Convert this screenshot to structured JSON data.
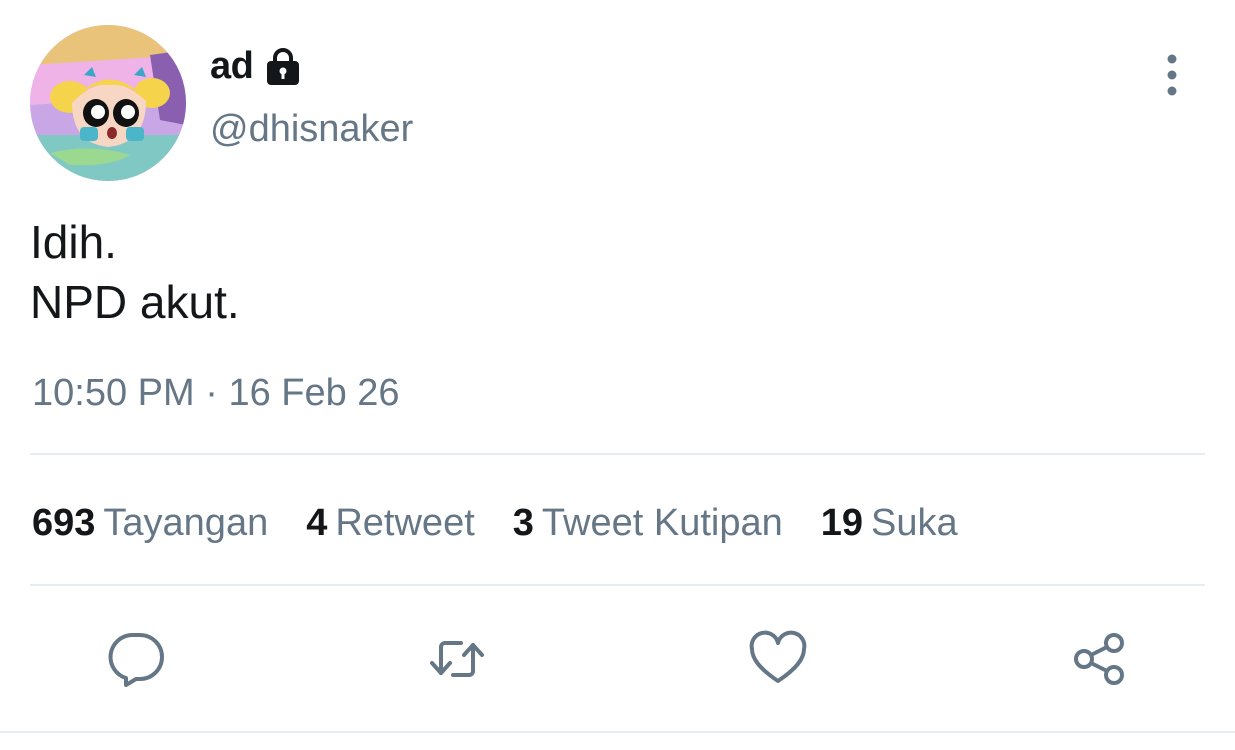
{
  "author": {
    "display_name": "ad",
    "handle": "@dhisnaker",
    "avatar_icon": "avatar-cartoon-girl",
    "protected_icon": "lock-icon"
  },
  "tweet": {
    "lines": [
      "Idih.",
      "NPD akut."
    ],
    "time": "10:50 PM",
    "separator": "·",
    "date": "16 Feb 26"
  },
  "stats": [
    {
      "count": "693",
      "label": "Tayangan"
    },
    {
      "count": "4",
      "label": "Retweet"
    },
    {
      "count": "3",
      "label": "Tweet Kutipan"
    },
    {
      "count": "19",
      "label": "Suka"
    }
  ],
  "actions": {
    "reply_icon": "reply-icon",
    "retweet_icon": "retweet-icon",
    "like_icon": "heart-icon",
    "share_icon": "share-icon",
    "more_icon": "more-vertical-icon"
  },
  "colors": {
    "text": "#14171a",
    "secondary": "#657786",
    "divider": "#e6ecf0",
    "icon": "#657786"
  }
}
